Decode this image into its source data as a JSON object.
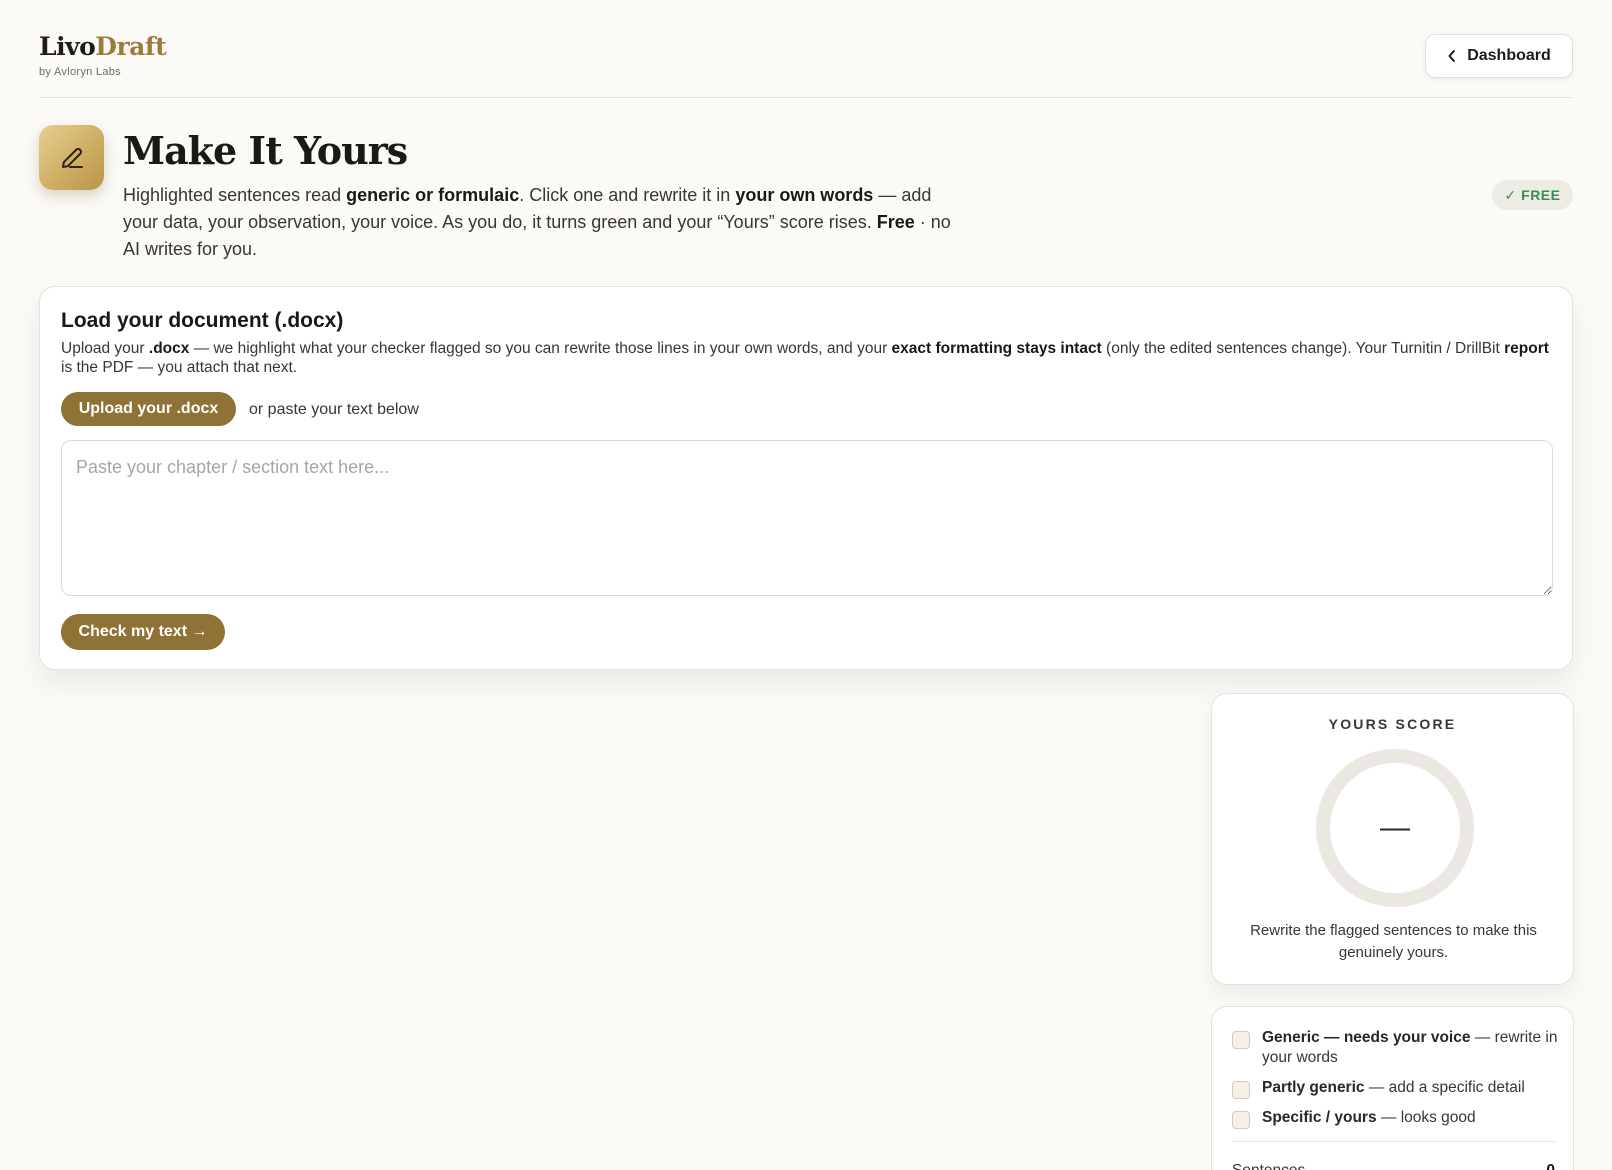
{
  "brand": {
    "logo_part1": "Livo",
    "logo_part2": "Draft",
    "byline": "by Avloryn Labs"
  },
  "nav": {
    "dashboard_label": "Dashboard"
  },
  "hero": {
    "title": "Make It Yours",
    "desc_1": "Highlighted sentences read ",
    "desc_2": "generic or formulaic",
    "desc_3": ". Click one and rewrite it in ",
    "desc_4": "your own words",
    "desc_5": " — add your data, your observation, your voice. As you do, it turns green and your “Yours” score rises. ",
    "desc_6": "Free",
    "desc_7": " · no AI writes for you.",
    "badge": "✓ FREE"
  },
  "load": {
    "title": "Load your document (.docx)",
    "desc_1": "Upload your ",
    "desc_2": ".docx",
    "desc_3": " — we highlight what your checker flagged so you can rewrite those lines in your own words, and your ",
    "desc_4": "exact formatting stays intact",
    "desc_5": " (only the edited sentences change). Your Turnitin / DrillBit ",
    "desc_6": "report",
    "desc_7": " is the PDF — you attach that next.",
    "upload_label": "Upload your .docx",
    "or_text": "or paste your text below",
    "paste_placeholder": "Paste your chapter / section text here...",
    "paste_value": "",
    "check_label": "Check my text →"
  },
  "score": {
    "label": "YOURS SCORE",
    "value": "—",
    "note": "Rewrite the flagged sentences to make this genuinely yours."
  },
  "legend": {
    "items": [
      {
        "bold": "Generic — needs your voice",
        "rest": " — rewrite in your words"
      },
      {
        "bold": "Partly generic",
        "rest": " — add a specific detail"
      },
      {
        "bold": "Specific / yours",
        "rest": " — looks good"
      }
    ],
    "stat_label": "Sentences",
    "stat_value": "0"
  }
}
